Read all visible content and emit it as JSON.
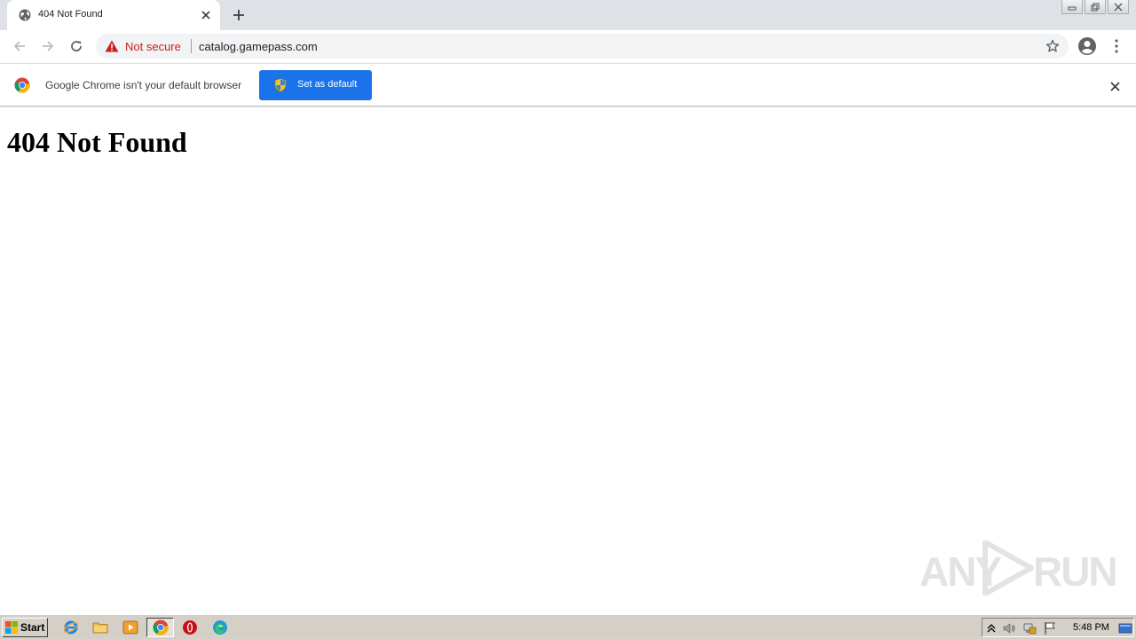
{
  "browser": {
    "tab": {
      "title": "404 Not Found",
      "favicon": "globe-icon"
    },
    "new_tab_icon": "plus-icon",
    "window_controls": [
      "minimize-icon",
      "restore-icon",
      "close-icon"
    ],
    "toolbar": {
      "back_icon": "arrow-left-icon",
      "forward_icon": "arrow-right-icon",
      "reload_icon": "reload-icon",
      "security_label": "Not secure",
      "security_icon": "warning-triangle-icon",
      "url": "catalog.gamepass.com",
      "bookmark_icon": "star-icon",
      "profile_icon": "account-circle-icon",
      "menu_icon": "kebab-menu-icon"
    },
    "infobar": {
      "message": "Google Chrome isn't your default browser",
      "button_label": "Set as default",
      "close_icon": "close-icon"
    }
  },
  "page": {
    "heading": "404 Not Found"
  },
  "watermark": {
    "left_text": "ANY",
    "right_text": "RUN"
  },
  "taskbar": {
    "start_label": "Start",
    "apps": [
      "internet-explorer-icon",
      "file-explorer-icon",
      "media-player-icon",
      "chrome-icon",
      "opera-icon",
      "edge-icon"
    ],
    "tray_icons": [
      "show-hidden-icon",
      "volume-icon",
      "network-icon",
      "action-center-flag-icon"
    ],
    "clock": "5:48 PM"
  },
  "colors": {
    "tab_strip": "#dee1e6",
    "omnibox": "#f1f3f4",
    "warning_red": "#c5221f",
    "accent_blue": "#1a73e8",
    "taskbar": "#d4d0c8"
  }
}
